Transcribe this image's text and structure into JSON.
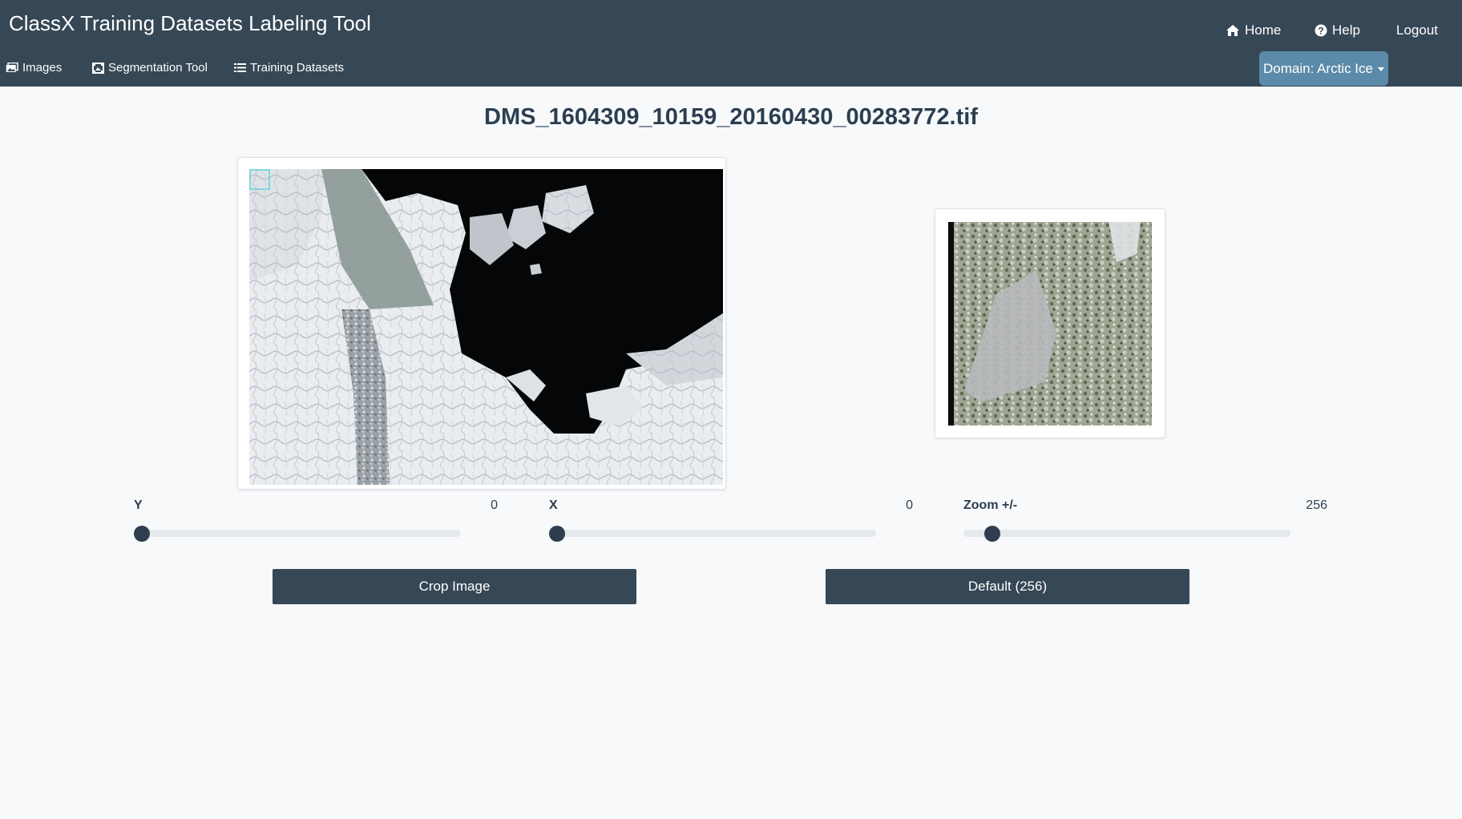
{
  "app": {
    "title": "ClassX Training Datasets Labeling Tool"
  },
  "topnav": {
    "home": "Home",
    "help": "Help",
    "logout": "Logout"
  },
  "subnav": {
    "images": "Images",
    "segmentation": "Segmentation Tool",
    "training": "Training Datasets"
  },
  "domain": {
    "label": "Domain: Arctic Ice"
  },
  "page": {
    "filename": "DMS_1604309_10159_20160430_00283772.tif"
  },
  "sliders": {
    "y": {
      "label": "Y",
      "value": "0"
    },
    "x": {
      "label": "X",
      "value": "0"
    },
    "zoom": {
      "label": "Zoom +/-",
      "value": "256"
    }
  },
  "buttons": {
    "crop": "Crop Image",
    "default": "Default (256)"
  },
  "colors": {
    "navbar": "#364756",
    "domain_button": "#5b8ba8",
    "slider_thumb": "#2e3e4e",
    "button": "#364756"
  },
  "icons": {
    "home": "home-icon",
    "help": "help-icon",
    "images": "images-icon",
    "segmentation": "crop-icon",
    "training": "list-icon"
  }
}
